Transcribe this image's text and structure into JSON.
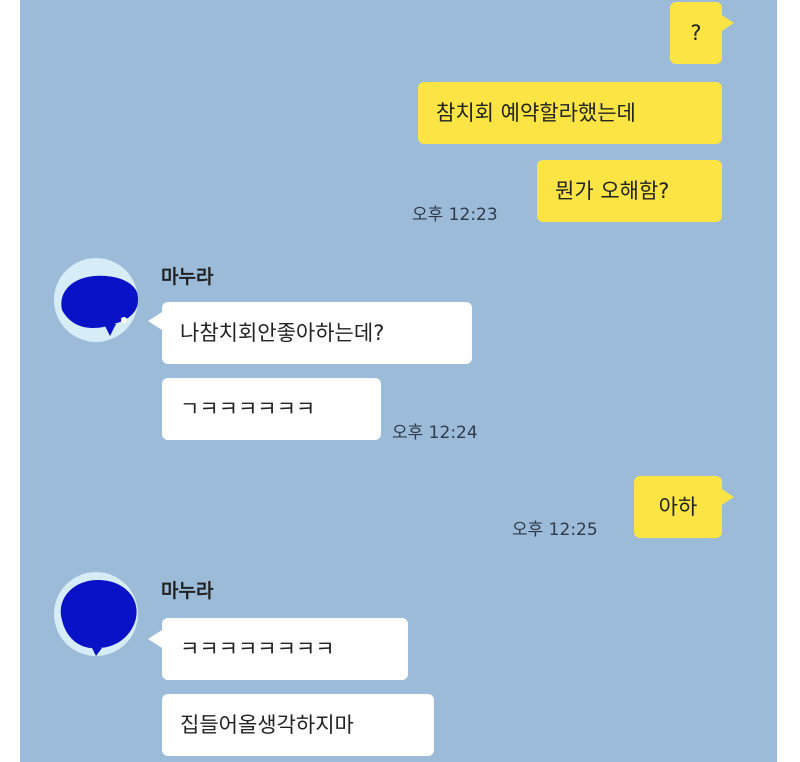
{
  "messages": [
    {
      "id": "m1",
      "from": "me",
      "text": "?"
    },
    {
      "id": "m2",
      "from": "me",
      "text": "참치회 예약할라했는데"
    },
    {
      "id": "m3",
      "from": "me",
      "text": "뭔가 오해함?",
      "time": "오후 12:23"
    },
    {
      "id": "m4",
      "from": "them",
      "sender": "마누라",
      "text": "나참치회안좋아하는데?"
    },
    {
      "id": "m5",
      "from": "them",
      "text": "ㄱㅋㅋㅋㅋㅋㅋ",
      "time": "오후 12:24"
    },
    {
      "id": "m6",
      "from": "me",
      "text": "아하",
      "time": "오후 12:25"
    },
    {
      "id": "m7",
      "from": "them",
      "sender": "마누라",
      "text": "ㅋㅋㅋㅋㅋㅋㅋㅋ"
    },
    {
      "id": "m8",
      "from": "them",
      "text": "집들어올생각하지마"
    }
  ],
  "colors": {
    "background": "#9bbbd8",
    "my_bubble": "#fbe443",
    "their_bubble": "#ffffff",
    "avatar_blob": "#0a12c8"
  },
  "icons": {
    "avatar": "profile-avatar-icon"
  }
}
